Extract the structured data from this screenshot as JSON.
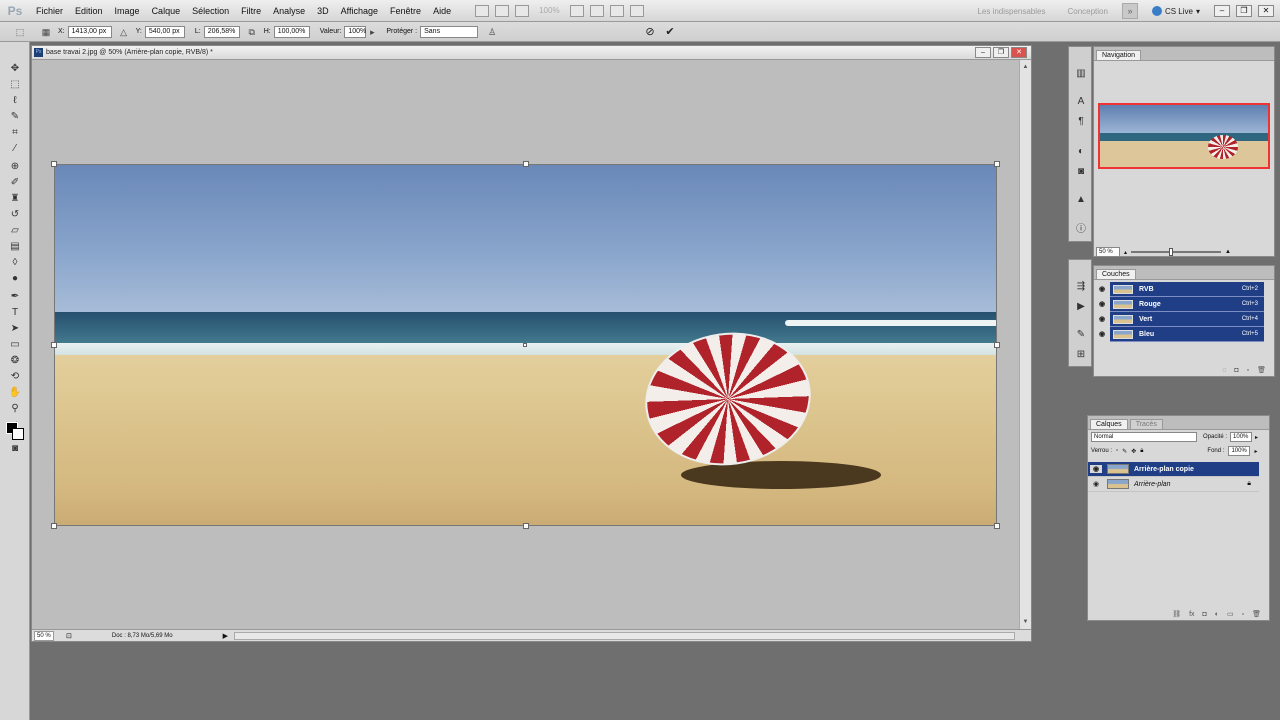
{
  "app": {
    "logo": "Ps"
  },
  "menu": [
    "Fichier",
    "Edition",
    "Image",
    "Calque",
    "Sélection",
    "Filtre",
    "Analyse",
    "3D",
    "Affichage",
    "Fenêtre",
    "Aide"
  ],
  "menubar": {
    "zoom": "100%"
  },
  "workspace": {
    "essentials": "Les indispensables",
    "design": "Conception",
    "cs_live": "CS Live"
  },
  "options": {
    "x_label": "X:",
    "x_value": "1413,00 px",
    "y_label": "Y:",
    "y_value": "540,00 px",
    "w_label": "L:",
    "w_value": "206,58%",
    "h_label": "H:",
    "h_value": "100,00%",
    "amount_label": "Valeur:",
    "amount_value": "100%",
    "protect_label": "Protéger :",
    "protect_value": "Sans"
  },
  "document": {
    "title": "base travai 2.jpg @ 50% (Arrière-plan copie, RVB/8) *",
    "zoom": "50 %",
    "info": "Doc : 8,73 Mo/5,69 Mo"
  },
  "navigator": {
    "tab": "Navigation",
    "zoom": "50 %"
  },
  "channels": {
    "tab": "Couches",
    "rows": [
      {
        "name": "RVB",
        "shortcut": "Ctrl+2"
      },
      {
        "name": "Rouge",
        "shortcut": "Ctrl+3"
      },
      {
        "name": "Vert",
        "shortcut": "Ctrl+4"
      },
      {
        "name": "Bleu",
        "shortcut": "Ctrl+5"
      }
    ]
  },
  "layers": {
    "tabs": [
      "Calques",
      "Tracés"
    ],
    "blend_mode": "Normal",
    "opacity_label": "Opacité :",
    "opacity_value": "100%",
    "lock_label": "Verrou :",
    "fill_label": "Fond :",
    "fill_value": "100%",
    "rows": [
      {
        "name": "Arrière-plan copie"
      },
      {
        "name": "Arrière-plan"
      }
    ]
  },
  "colors": {
    "selection": "#1f3e86",
    "umbrella_red": "#b0232a"
  }
}
